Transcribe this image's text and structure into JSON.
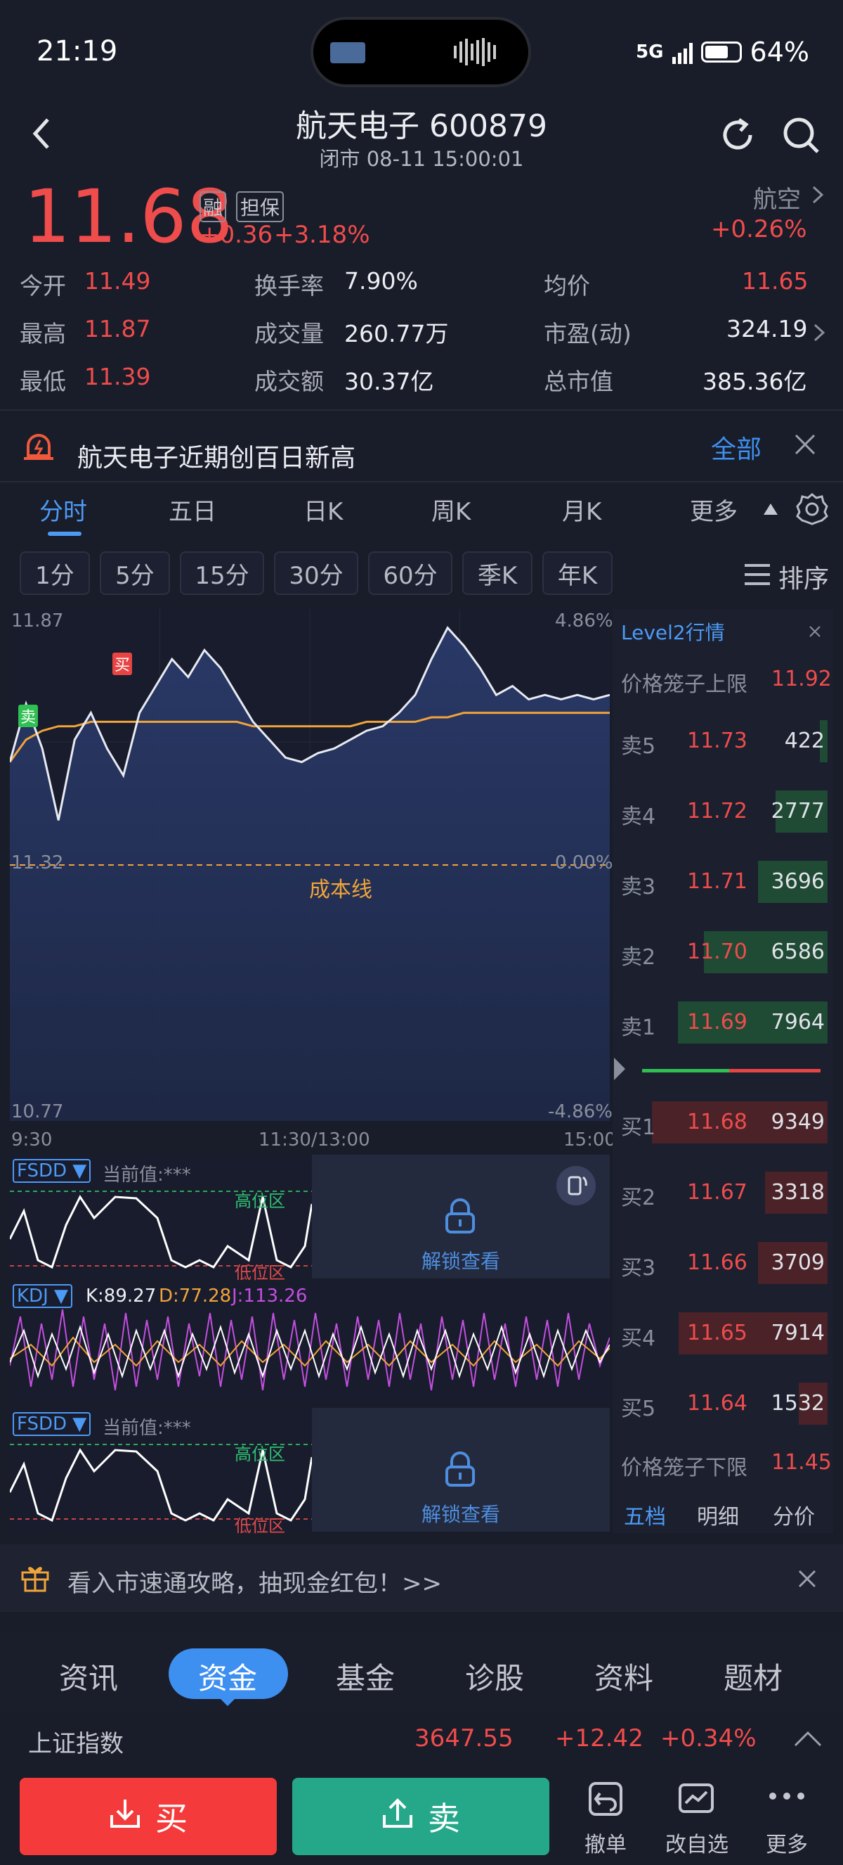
{
  "status": {
    "time": "21:19",
    "network": "5G",
    "battery": "64%"
  },
  "header": {
    "title": "航天电子 600879",
    "subtitle": "闭市 08-11 15:00:01"
  },
  "quote": {
    "price": "11.68",
    "badge1": "融",
    "badge2": "担保",
    "change": "+0.36",
    "change_pct": "+3.18%",
    "sector": "航空",
    "sector_pct": "+0.26%"
  },
  "stats": {
    "open_label": "今开",
    "open": "11.49",
    "turnover_label": "换手率",
    "turnover": "7.90%",
    "avg_label": "均价",
    "avg": "11.65",
    "high_label": "最高",
    "high": "11.87",
    "volume_label": "成交量",
    "volume": "260.77万",
    "pe_label": "市盈(动)",
    "pe": "324.19",
    "low_label": "最低",
    "low": "11.39",
    "amount_label": "成交额",
    "amount": "30.37亿",
    "mcap_label": "总市值",
    "mcap": "385.36亿"
  },
  "alert": {
    "text": "航天电子近期创百日新高",
    "link": "全部"
  },
  "tabs": [
    "分时",
    "五日",
    "日K",
    "周K",
    "月K",
    "更多"
  ],
  "chips": [
    "1分",
    "5分",
    "15分",
    "30分",
    "60分",
    "季K",
    "年K"
  ],
  "sort_label": "排序",
  "chart_data": {
    "type": "line",
    "title": "",
    "y_left_top": "11.87",
    "y_left_mid": "11.32",
    "y_left_bot": "10.77",
    "y_right_top": "4.86%",
    "y_right_mid": "0.00%",
    "y_right_bot": "-4.86%",
    "x_labels": [
      "9:30",
      "11:30/13:00",
      "15:00"
    ],
    "cost_line_label": "成本线",
    "buy_marker": "买",
    "sell_marker": "卖",
    "ylim": [
      10.77,
      11.87
    ],
    "series": [
      {
        "values": [
          11.55,
          11.68,
          11.58,
          11.42,
          11.6,
          11.66,
          11.58,
          11.52,
          11.66,
          11.72,
          11.78,
          11.74,
          11.8,
          11.76,
          11.7,
          11.64,
          11.6,
          11.56,
          11.55,
          11.57,
          11.58,
          11.6,
          11.62,
          11.63,
          11.66,
          11.7,
          11.78,
          11.85,
          11.81,
          11.76,
          11.7,
          11.72,
          11.69,
          11.7,
          11.69,
          11.7,
          11.69,
          11.7
        ]
      },
      {
        "values": [
          11.55,
          11.6,
          11.62,
          11.63,
          11.63,
          11.64,
          11.64,
          11.64,
          11.64,
          11.64,
          11.64,
          11.64,
          11.64,
          11.64,
          11.64,
          11.63,
          11.63,
          11.63,
          11.63,
          11.63,
          11.63,
          11.63,
          11.64,
          11.64,
          11.64,
          11.64,
          11.65,
          11.65,
          11.66,
          11.66,
          11.66,
          11.66,
          11.66,
          11.66,
          11.66,
          11.66,
          11.66,
          11.66
        ]
      }
    ]
  },
  "indicators": {
    "fsdd_label": "FSDD ▼",
    "fsdd_value": "当前值:***",
    "high_zone": "高位区",
    "low_zone": "低位区",
    "unlock": "解锁查看",
    "kdj_label": "KDJ ▼",
    "kdj_k": "K:89.27",
    "kdj_d": "D:77.28",
    "kdj_j": "J:113.26"
  },
  "orderbook": {
    "title": "Level2行情",
    "upper_label": "价格笼子上限",
    "upper": "11.92",
    "lower_label": "价格笼子下限",
    "lower": "11.45",
    "asks": [
      {
        "label": "卖5",
        "price": "11.73",
        "vol": "422",
        "vol_num": 422
      },
      {
        "label": "卖4",
        "price": "11.72",
        "vol": "2777",
        "vol_num": 2777
      },
      {
        "label": "卖3",
        "price": "11.71",
        "vol": "3696",
        "vol_num": 3696
      },
      {
        "label": "卖2",
        "price": "11.70",
        "vol": "6586",
        "vol_num": 6586
      },
      {
        "label": "卖1",
        "price": "11.69",
        "vol": "7964",
        "vol_num": 7964
      }
    ],
    "bids": [
      {
        "label": "买1",
        "price": "11.68",
        "vol": "9349",
        "vol_num": 9349
      },
      {
        "label": "买2",
        "price": "11.67",
        "vol": "3318",
        "vol_num": 3318
      },
      {
        "label": "买3",
        "price": "11.66",
        "vol": "3709",
        "vol_num": 3709
      },
      {
        "label": "买4",
        "price": "11.65",
        "vol": "7914",
        "vol_num": 7914
      },
      {
        "label": "买5",
        "price": "11.64",
        "vol": "1532",
        "vol_num": 1532
      }
    ],
    "tabs": [
      "五档",
      "明细",
      "分价"
    ]
  },
  "promo": {
    "text": "看入市速通攻略，抽现金红包！>>"
  },
  "nav": [
    "资讯",
    "资金",
    "基金",
    "诊股",
    "资料",
    "题材"
  ],
  "index": {
    "name": "上证指数",
    "value": "3647.55",
    "change": "+12.42",
    "pct": "+0.34%"
  },
  "actions": {
    "buy": "买",
    "sell": "卖",
    "cancel": "撤单",
    "edit": "改自选",
    "more": "更多"
  }
}
